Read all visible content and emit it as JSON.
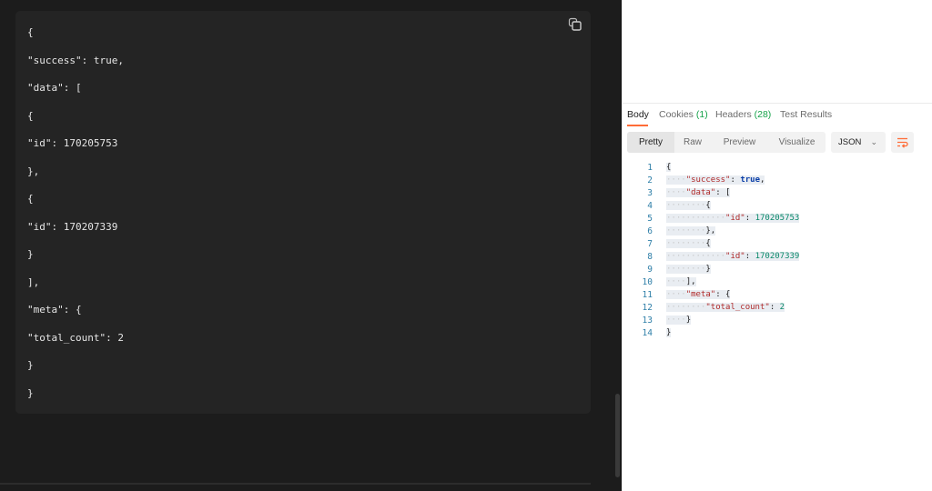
{
  "left_panel": {
    "code_lines": [
      "{",
      "\"success\": true,",
      "\"data\": [",
      "{",
      "\"id\": 170205753",
      "},",
      "{",
      "\"id\": 170207339",
      "}",
      "],",
      "\"meta\": {",
      "\"total_count\": 2",
      "}",
      "}"
    ],
    "copy_icon": "copy-icon"
  },
  "response": {
    "tabs": [
      {
        "label": "Body"
      },
      {
        "label": "Cookies",
        "count": "(1)"
      },
      {
        "label": "Headers",
        "count": "(28)"
      },
      {
        "label": "Test Results"
      }
    ],
    "view_modes": [
      "Pretty",
      "Raw",
      "Preview",
      "Visualize"
    ],
    "active_view": "Pretty",
    "format": "JSON",
    "wrap_icon": "wrap-lines-icon",
    "accent_color": "#ff6c37",
    "line_numbers": [
      "1",
      "2",
      "3",
      "4",
      "5",
      "6",
      "7",
      "8",
      "9",
      "10",
      "11",
      "12",
      "13",
      "14"
    ]
  }
}
